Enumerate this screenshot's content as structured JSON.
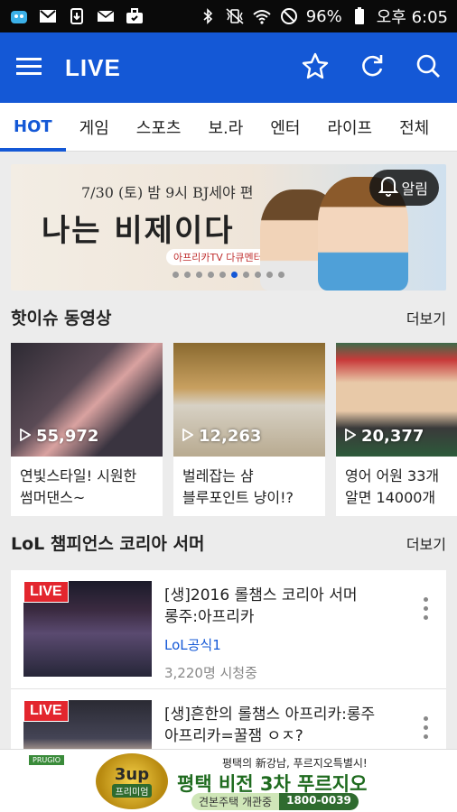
{
  "status_bar": {
    "battery": "96%",
    "time": "오후 6:05",
    "left_icons": [
      "app-notification-icon",
      "gmail-icon",
      "download-icon",
      "mail-icon",
      "briefcase-icon"
    ],
    "right_icons": [
      "bluetooth-icon",
      "vibrate-icon",
      "wifi-icon",
      "do-not-disturb-icon",
      "battery-icon"
    ]
  },
  "app_bar": {
    "title": "LIVE",
    "background": "#1458d6"
  },
  "tabs": [
    {
      "label": "HOT",
      "active": true
    },
    {
      "label": "게임",
      "active": false
    },
    {
      "label": "스포츠",
      "active": false
    },
    {
      "label": "보.라",
      "active": false
    },
    {
      "label": "엔터",
      "active": false
    },
    {
      "label": "라이프",
      "active": false
    },
    {
      "label": "전체",
      "active": false
    }
  ],
  "banner": {
    "subtitle": "7/30 (토) 밤 9시 BJ세야 편",
    "headline": "나는 비제이다",
    "tagline": "아프리카TV 다큐멘터리",
    "alarm_label": "알림",
    "page_count": 10,
    "active_page": 5
  },
  "hot_videos": {
    "title": "핫이슈 동영상",
    "more": "더보기",
    "items": [
      {
        "views": "55,972",
        "title": "연빛스타일! 시원한\n썸머댄스~"
      },
      {
        "views": "12,263",
        "title": "벌레잡는 샴\n블루포인트 냥이!?"
      },
      {
        "views": "20,377",
        "title": "영어 어원 33개\n알면 14000개"
      }
    ]
  },
  "lol_section": {
    "title": "LoL 챔피언스 코리아 서머",
    "more": "더보기",
    "live_badge": "LIVE",
    "items": [
      {
        "title": "[생]2016 롤챔스 코리아 서머\n롱주:아프리카",
        "channel": "LoL공식1",
        "viewers": "3,220명 시청중"
      },
      {
        "title": "[생]흔한의 롤챔스 아프리카:롱주\n아프리카=꿀잼 ㅇㅈ?",
        "channel": "",
        "viewers": ""
      }
    ]
  },
  "ad": {
    "brand": "PRUGIO",
    "medal_big": "3up",
    "medal_small": "프리미엄",
    "line1": "평택의 新강남, 푸르지오특별시!",
    "line2": "평택 비전 3차 푸르지오",
    "line3a": "견본주택 개관중",
    "line3b": "1800-0039"
  }
}
